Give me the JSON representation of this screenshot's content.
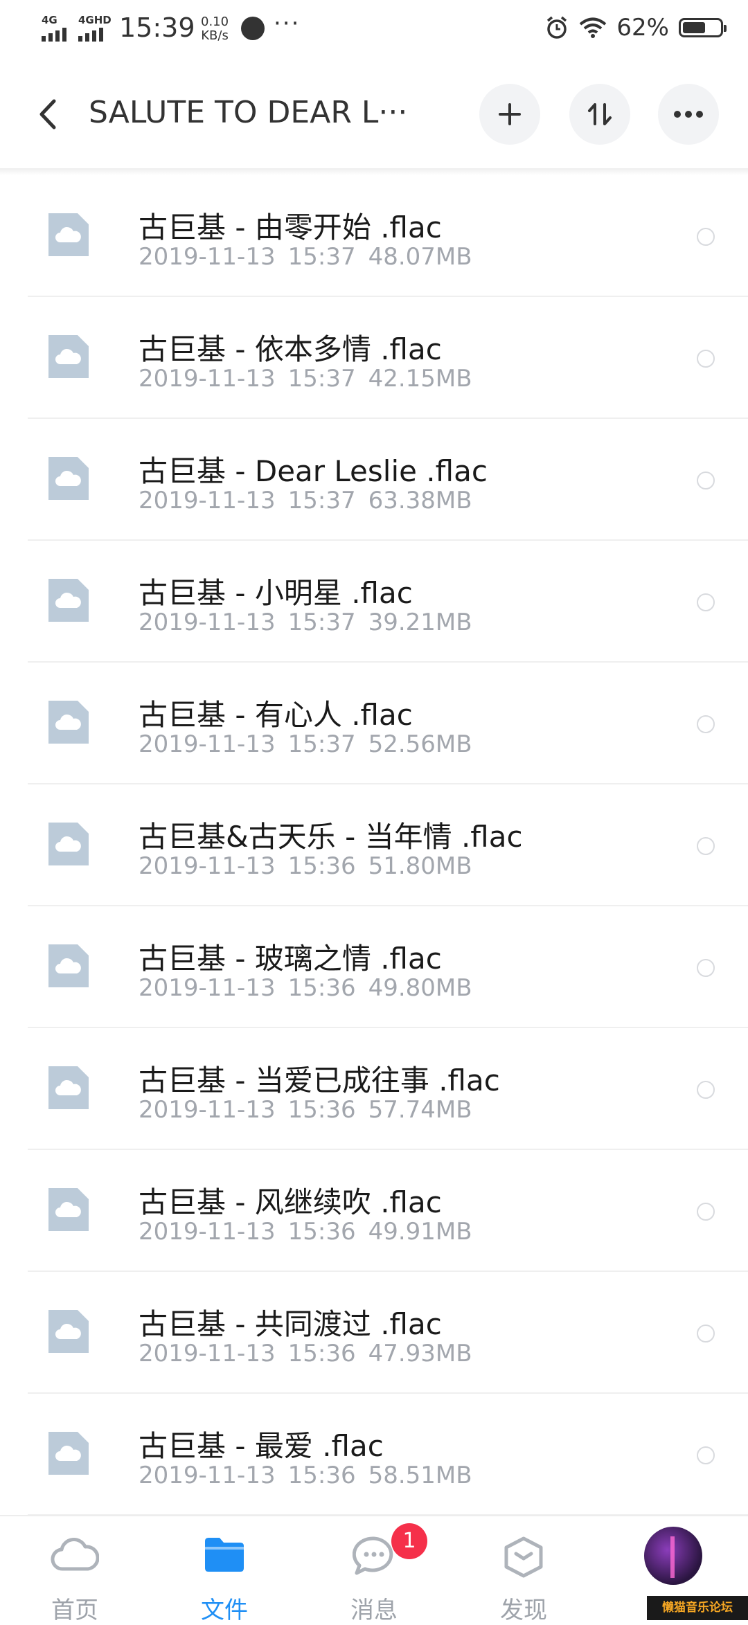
{
  "status_bar": {
    "sim1": "4G",
    "sim2": "4GHD",
    "time": "15:39",
    "speed_value": "0.10",
    "speed_unit": "KB/s",
    "more": "···",
    "battery": "62%",
    "battery_level": 0.62
  },
  "header": {
    "title": "SALUTE TO DEAR L···"
  },
  "files": [
    {
      "name": "古巨基 - 由零开始 .flac",
      "date": "2019-11-13",
      "time": "15:37",
      "size": "48.07MB"
    },
    {
      "name": "古巨基 - 依本多情 .flac",
      "date": "2019-11-13",
      "time": "15:37",
      "size": "42.15MB"
    },
    {
      "name": "古巨基 - Dear Leslie .flac",
      "date": "2019-11-13",
      "time": "15:37",
      "size": "63.38MB"
    },
    {
      "name": "古巨基 - 小明星 .flac",
      "date": "2019-11-13",
      "time": "15:37",
      "size": "39.21MB"
    },
    {
      "name": "古巨基 - 有心人 .flac",
      "date": "2019-11-13",
      "time": "15:37",
      "size": "52.56MB"
    },
    {
      "name": "古巨基&古天乐 - 当年情 .flac",
      "date": "2019-11-13",
      "time": "15:36",
      "size": "51.80MB"
    },
    {
      "name": "古巨基 - 玻璃之情 .flac",
      "date": "2019-11-13",
      "time": "15:36",
      "size": "49.80MB"
    },
    {
      "name": "古巨基 - 当爱已成往事 .flac",
      "date": "2019-11-13",
      "time": "15:36",
      "size": "57.74MB"
    },
    {
      "name": "古巨基 - 风继续吹 .flac",
      "date": "2019-11-13",
      "time": "15:36",
      "size": "49.91MB"
    },
    {
      "name": "古巨基 - 共同渡过 .flac",
      "date": "2019-11-13",
      "time": "15:36",
      "size": "47.93MB"
    },
    {
      "name": "古巨基 - 最爱 .flac",
      "date": "2019-11-13",
      "time": "15:36",
      "size": "58.51MB"
    }
  ],
  "bottom_nav": {
    "items": [
      {
        "label": "首页",
        "icon": "cloud-icon"
      },
      {
        "label": "文件",
        "icon": "folder-icon"
      },
      {
        "label": "消息",
        "icon": "chat-bubble-icon"
      },
      {
        "label": "发现",
        "icon": "discover-hexagon-icon"
      }
    ],
    "message_badge": "1",
    "active_index": 1
  },
  "watermark": "懒猫音乐论坛",
  "colors": {
    "accent": "#1f8ff5",
    "badge": "#f5304a",
    "file_icon": "#bccbd9",
    "meta_text": "#a2a6ad"
  }
}
